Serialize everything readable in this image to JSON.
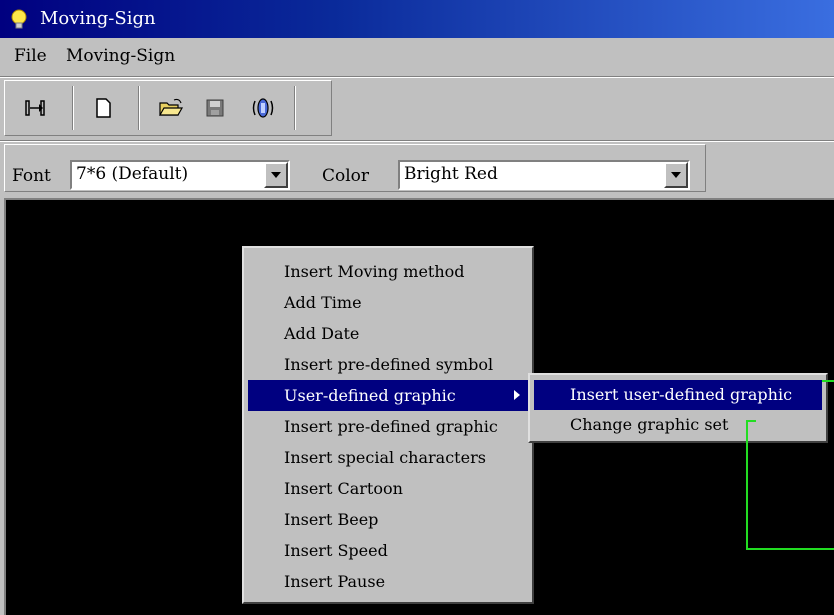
{
  "window": {
    "title": "Moving-Sign",
    "icon": "lightbulb-icon"
  },
  "menubar": {
    "items": [
      "File",
      "Moving-Sign"
    ]
  },
  "toolbar": {
    "icons": [
      "send-icon",
      "new-file-icon",
      "open-folder-icon",
      "save-icon",
      "sound-icon"
    ]
  },
  "fontbar": {
    "font_label": "Font",
    "font_value": "7*6 (Default)",
    "color_label": "Color",
    "color_value": "Bright Red"
  },
  "context_menu": {
    "items": [
      "Insert Moving method",
      "Add Time",
      "Add Date",
      "Insert pre-defined symbol",
      "User-defined graphic",
      "Insert pre-defined graphic",
      "Insert special characters",
      "Insert Cartoon",
      "Insert Beep",
      "Insert Speed",
      "Insert Pause"
    ],
    "selected_index": 4
  },
  "submenu": {
    "items": [
      "Insert user-defined graphic",
      "Change graphic set"
    ],
    "selected_index": 0
  },
  "colors": {
    "title_start": "#000080",
    "title_end": "#3a6ee0",
    "highlight": "#000080",
    "canvas": "#000000",
    "callout": "#22dd22"
  }
}
